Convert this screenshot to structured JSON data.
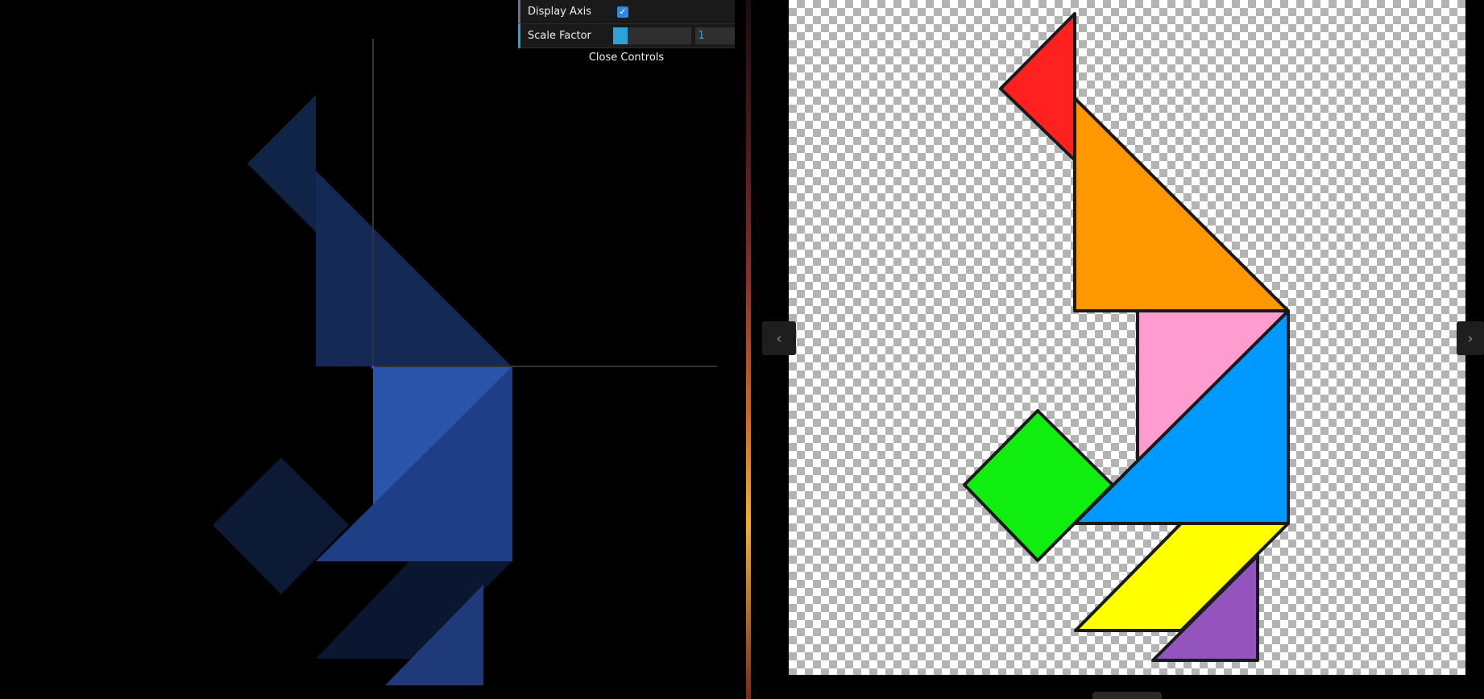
{
  "controls": {
    "display_axis_label": "Display Axis",
    "display_axis_checked": true,
    "scale_factor_label": "Scale Factor",
    "scale_factor_value": "1",
    "scale_factor_fraction": 0.18,
    "close_label": "Close Controls"
  },
  "viewer": {
    "prev_icon": "chevron-left-icon",
    "next_icon": "chevron-right-icon"
  },
  "colors": {
    "red": "#ff2020",
    "orange": "#ff9800",
    "pink": "#ff9ccf",
    "blue": "#0099ff",
    "green": "#10ee10",
    "yellow": "#ffff00",
    "purple": "#9355bd",
    "scene_blue": "#2a56ad",
    "accent": "#2fa1d6"
  }
}
